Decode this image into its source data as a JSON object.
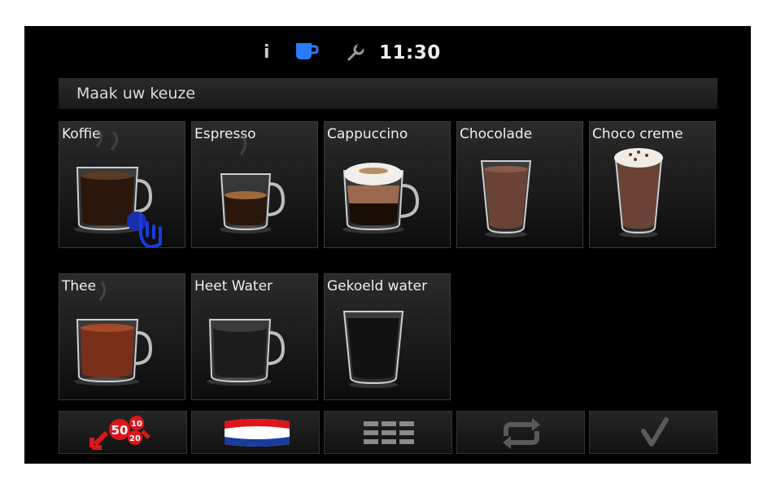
{
  "status": {
    "info_icon": "info-icon",
    "cup_icon": "coffee-cup-icon",
    "tool_icon": "wrench-icon",
    "time": "11:30"
  },
  "prompt": {
    "text": "Maak uw keuze"
  },
  "drinks": [
    {
      "label": "Koffie"
    },
    {
      "label": "Espresso"
    },
    {
      "label": "Cappuccino"
    },
    {
      "label": "Chocolade"
    },
    {
      "label": "Choco creme"
    },
    {
      "label": "Thee"
    },
    {
      "label": "Heet Water"
    },
    {
      "label": "Gekoeld water"
    }
  ],
  "toolbar": {
    "price_badges": [
      "50",
      "10",
      "20"
    ],
    "language_flag": "flag-netherlands-icon",
    "menu_icon": "grid-menu-icon",
    "repeat_icon": "repeat-icon",
    "confirm_icon": "checkmark-icon"
  },
  "colors": {
    "accent_blue": "#2a7bff",
    "badge_red": "#e0141b",
    "background": "#000000"
  }
}
